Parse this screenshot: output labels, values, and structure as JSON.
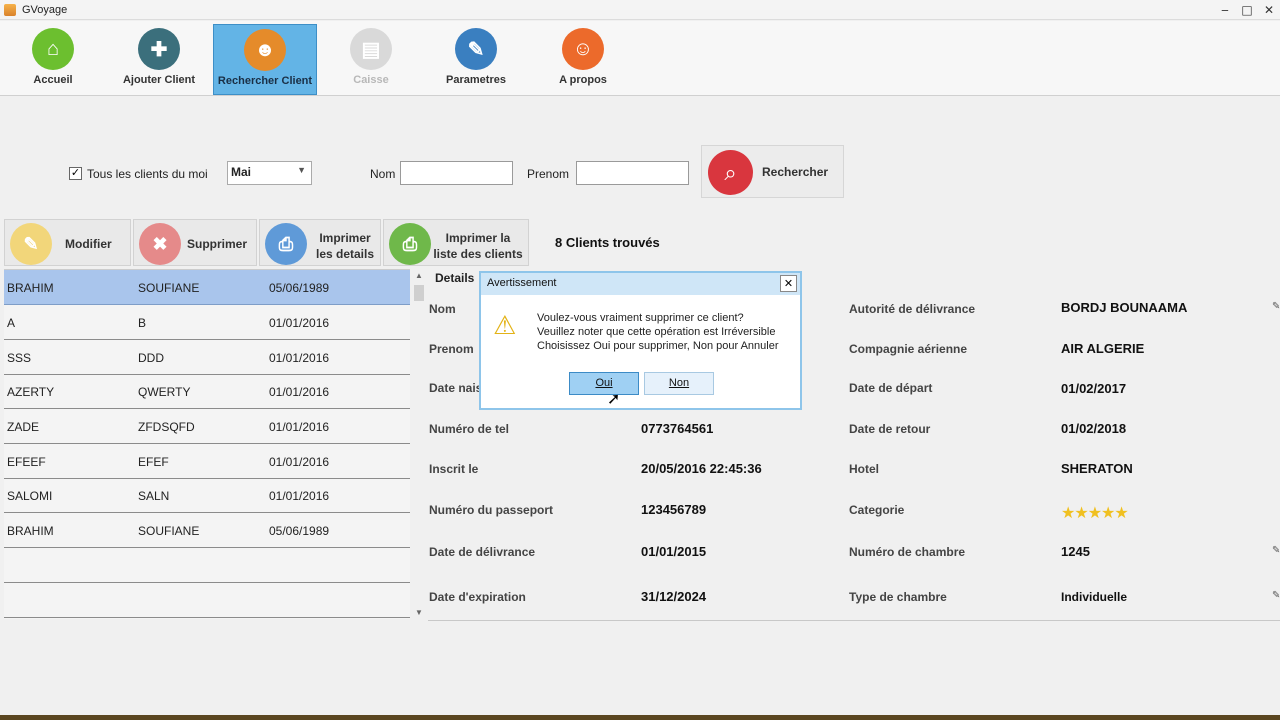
{
  "window": {
    "title": "GVoyage",
    "controls": [
      "‒",
      "□",
      "✕"
    ]
  },
  "toolbar": {
    "items": [
      {
        "label": "Accueil",
        "icon": "home-icon",
        "color": "#6cbf2f",
        "state": "normal"
      },
      {
        "label": "Ajouter Client",
        "icon": "add-user-icon",
        "color": "#3b6f7c",
        "state": "normal"
      },
      {
        "label": "Rechercher Client",
        "icon": "search-user-icon",
        "color": "#e58b2a",
        "state": "active"
      },
      {
        "label": "Caisse",
        "icon": "cashbox-icon",
        "color": "#c8c8c8",
        "state": "disabled"
      },
      {
        "label": "Parametres",
        "icon": "wrench-icon",
        "color": "#3a7fc0",
        "state": "normal"
      },
      {
        "label": "A propos",
        "icon": "group-icon",
        "color": "#ec6a2b",
        "state": "normal"
      }
    ]
  },
  "search": {
    "all_month_checked": true,
    "all_month_label": "Tous les clients du moi",
    "month_value": "Mai",
    "nom_label": "Nom",
    "nom_value": "",
    "prenom_label": "Prenom",
    "prenom_value": "",
    "search_button_label": "Rechercher"
  },
  "actions": {
    "modify_label": "Modifier",
    "delete_label": "Supprimer",
    "print_details_line1": "Imprimer",
    "print_details_line2": "les details",
    "print_list_line1": "Imprimer la",
    "print_list_line2": "liste des clients",
    "found_text": "8 Clients trouvés"
  },
  "clients": [
    {
      "nom": "BRAHIM",
      "prenom": "SOUFIANE",
      "date": "05/06/1989",
      "selected": true
    },
    {
      "nom": "A",
      "prenom": "B",
      "date": "01/01/2016",
      "selected": false
    },
    {
      "nom": "SSS",
      "prenom": "DDD",
      "date": "01/01/2016",
      "selected": false
    },
    {
      "nom": "AZERTY",
      "prenom": "QWERTY",
      "date": "01/01/2016",
      "selected": false
    },
    {
      "nom": "ZADE",
      "prenom": "ZFDSQFD",
      "date": "01/01/2016",
      "selected": false
    },
    {
      "nom": "EFEEF",
      "prenom": "EFEF",
      "date": "01/01/2016",
      "selected": false
    },
    {
      "nom": "SALOMI",
      "prenom": "SALN",
      "date": "01/01/2016",
      "selected": false
    },
    {
      "nom": "BRAHIM",
      "prenom": "SOUFIANE",
      "date": "05/06/1989",
      "selected": false
    }
  ],
  "details": {
    "title": "Details",
    "left": [
      {
        "label": "Nom",
        "value": ""
      },
      {
        "label": "Prenom",
        "value": ""
      },
      {
        "label": "Date nais",
        "value": ""
      },
      {
        "label": "Numéro de tel",
        "value": "0773764561"
      },
      {
        "label": "Inscrit le",
        "value": "20/05/2016 22:45:36"
      },
      {
        "label": "Numéro du passeport",
        "value": "123456789"
      },
      {
        "label": "Date de délivrance",
        "value": "01/01/2015"
      },
      {
        "label": "Date d'expiration",
        "value": "31/12/2024"
      }
    ],
    "right": [
      {
        "label": "Autorité de délivrance",
        "value": "BORDJ BOUNAAMA"
      },
      {
        "label": "Compagnie aérienne",
        "value": "AIR ALGERIE"
      },
      {
        "label": "Date de départ",
        "value": "01/02/2017"
      },
      {
        "label": "Date de retour",
        "value": "01/02/2018"
      },
      {
        "label": "Hotel",
        "value": "SHERATON"
      },
      {
        "label": "Categorie",
        "value": ""
      },
      {
        "label": "Numéro de chambre",
        "value": "1245"
      },
      {
        "label": "Type de chambre",
        "value": "Individuelle"
      }
    ],
    "hotel_stars": 5
  },
  "dialog": {
    "title": "Avertissement",
    "close": "✕",
    "line1": "Voulez-vous vraiment supprimer ce client?",
    "line2": "Veuillez noter que cette opération est Irréversible",
    "line3": "Choisissez Oui pour supprimer, Non pour Annuler",
    "yes_label": "Oui",
    "no_label": "Non"
  }
}
